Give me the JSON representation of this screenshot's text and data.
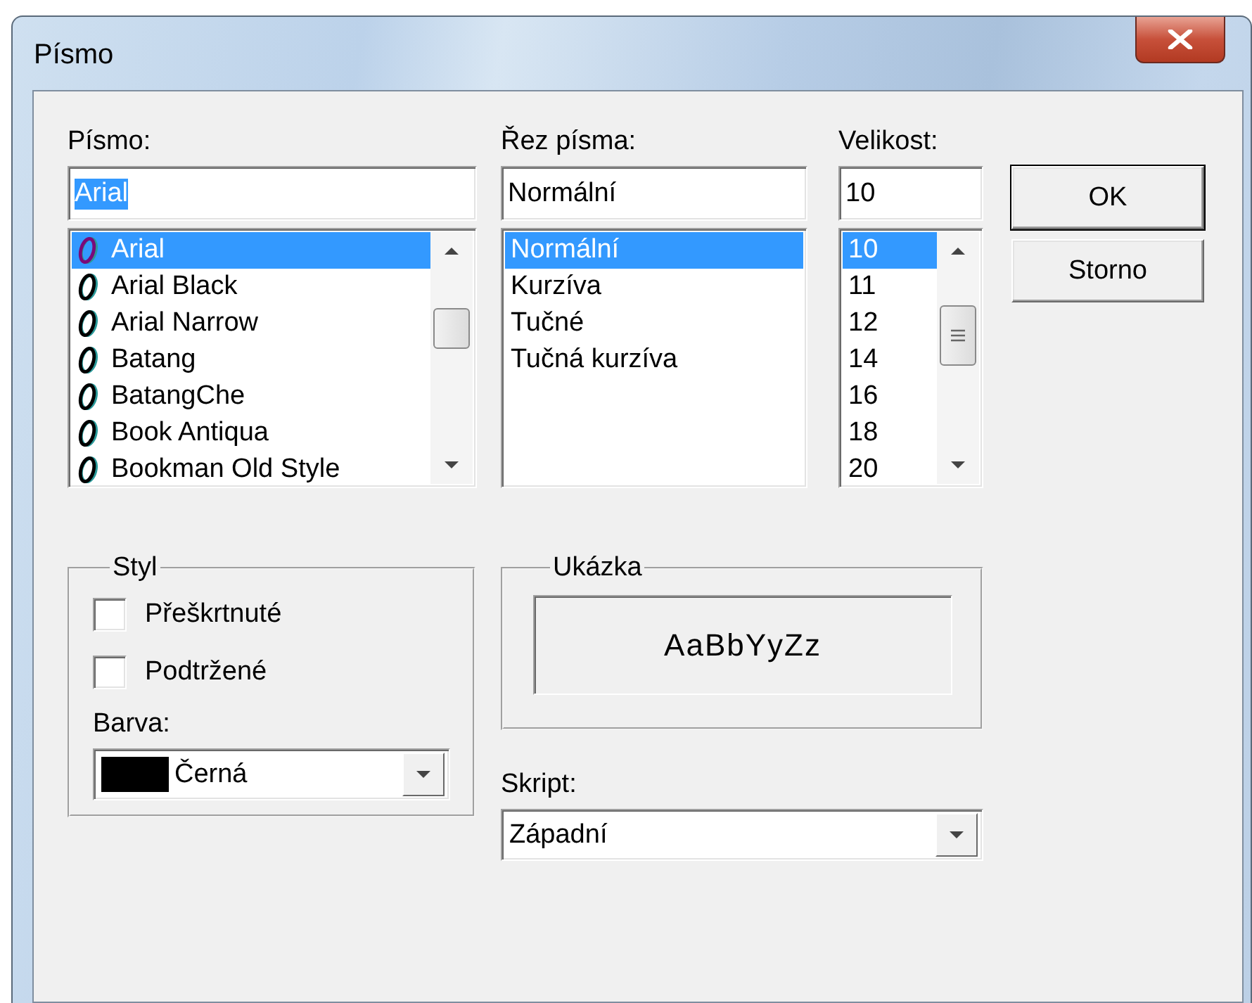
{
  "window": {
    "title": "Písmo"
  },
  "font": {
    "label": "Písmo:",
    "value": "Arial",
    "value_highlighted": true,
    "items": [
      {
        "name": "Arial",
        "selected": true
      },
      {
        "name": "Arial Black",
        "selected": false
      },
      {
        "name": "Arial Narrow",
        "selected": false
      },
      {
        "name": "Batang",
        "selected": false
      },
      {
        "name": "BatangChe",
        "selected": false
      },
      {
        "name": "Book Antiqua",
        "selected": false
      },
      {
        "name": "Bookman Old Style",
        "selected": false
      }
    ]
  },
  "font_style": {
    "label": "Řez písma:",
    "value": "Normální",
    "items": [
      {
        "name": "Normální",
        "selected": true
      },
      {
        "name": "Kurzíva",
        "selected": false
      },
      {
        "name": "Tučné",
        "selected": false
      },
      {
        "name": "Tučná kurzíva",
        "selected": false
      }
    ]
  },
  "size": {
    "label": "Velikost:",
    "value": "10",
    "items": [
      {
        "name": "10",
        "selected": true
      },
      {
        "name": "11",
        "selected": false
      },
      {
        "name": "12",
        "selected": false
      },
      {
        "name": "14",
        "selected": false
      },
      {
        "name": "16",
        "selected": false
      },
      {
        "name": "18",
        "selected": false
      },
      {
        "name": "20",
        "selected": false
      }
    ]
  },
  "buttons": [
    {
      "label": "OK",
      "default": true
    },
    {
      "label": "Storno",
      "default": false
    }
  ],
  "effects": {
    "title": "Styl",
    "checkboxes": [
      {
        "label": "Přeškrtnuté",
        "checked": false
      },
      {
        "label": "Podtržené",
        "checked": false
      }
    ],
    "color_label": "Barva:",
    "color_field": {
      "value": "Černá",
      "color": "#000000"
    }
  },
  "sample": {
    "title": "Ukázka",
    "text": "AaBbYyZz"
  },
  "script": {
    "label": "Skript:",
    "value": "Západní"
  }
}
